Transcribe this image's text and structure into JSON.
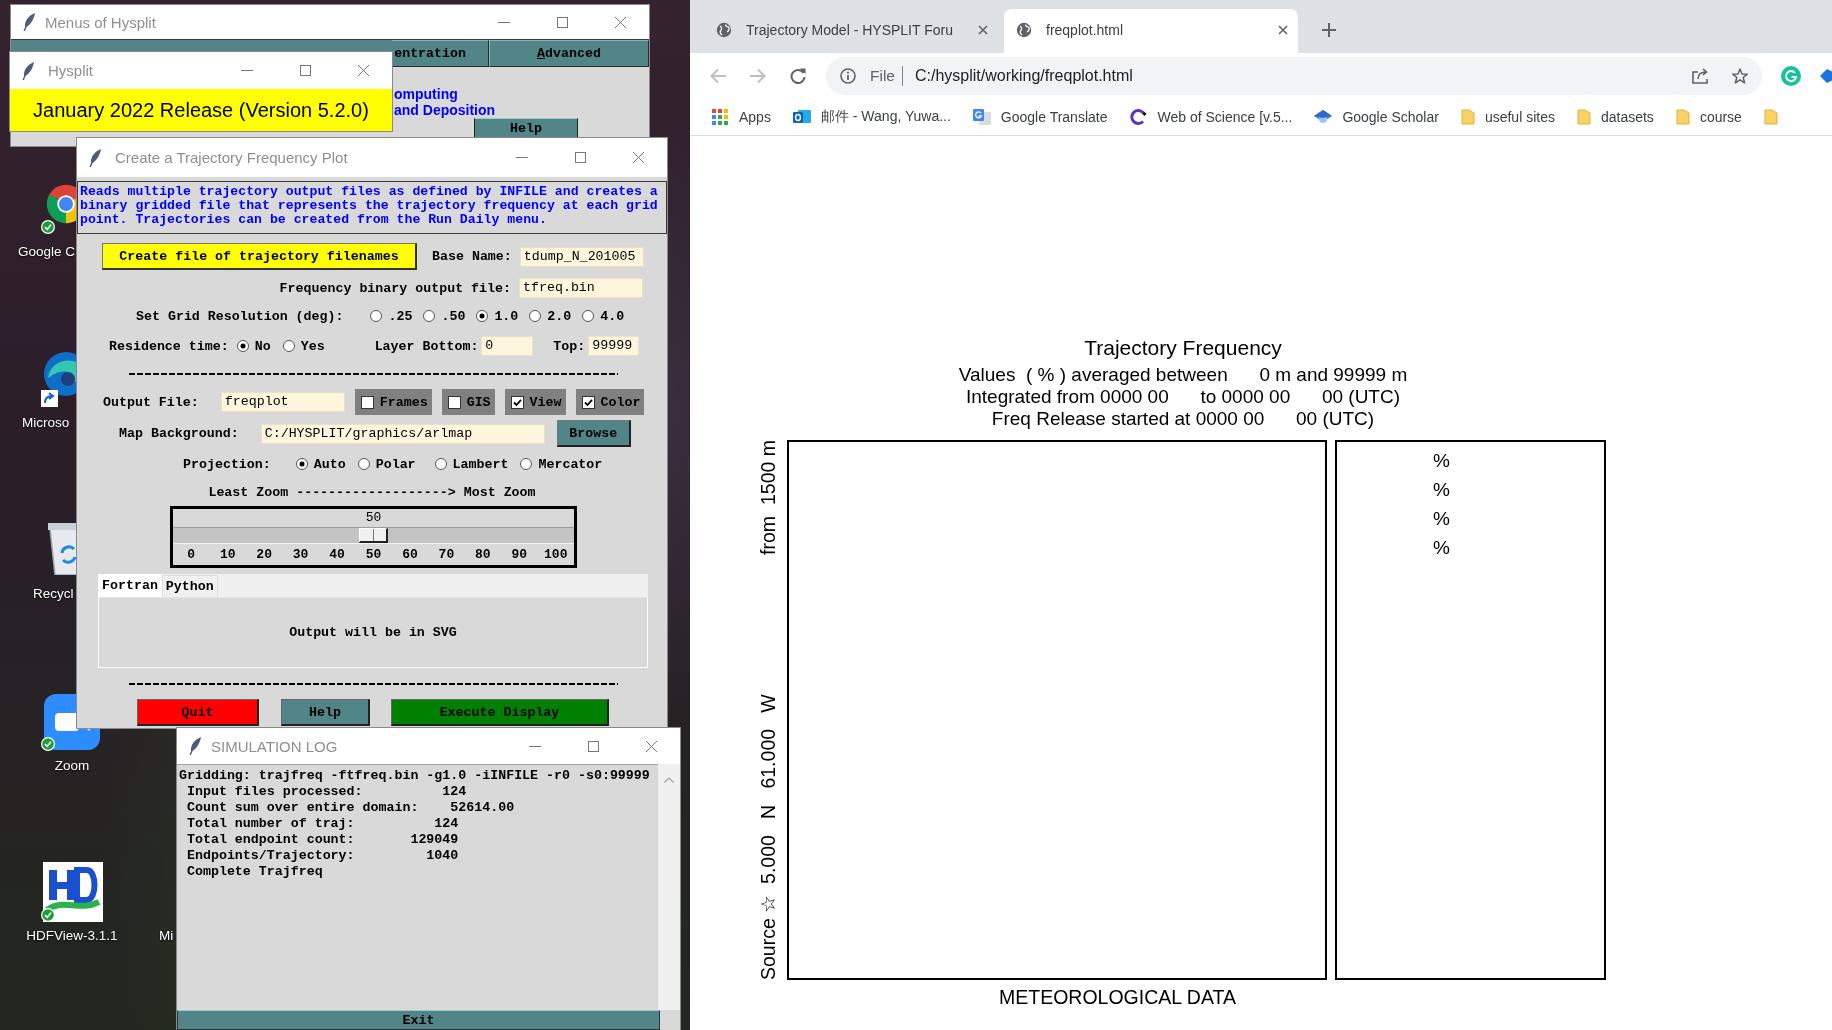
{
  "desktop": {
    "icons": [
      {
        "label": "Google C",
        "synced": true,
        "shortcut": false
      },
      {
        "label": "Microso",
        "synced": false,
        "shortcut": true
      },
      {
        "label": "Recycl",
        "synced": false,
        "shortcut": false
      },
      {
        "label": "Zoom",
        "synced": true,
        "shortcut": false
      },
      {
        "label": "HDFView-3.1.1",
        "synced": true,
        "shortcut": false
      },
      {
        "label": "Mi",
        "synced": false,
        "shortcut": false
      }
    ]
  },
  "menus_window": {
    "title": "Menus of Hysplit",
    "menu_buttons": [
      {
        "label": "entration",
        "mnemonic": false
      },
      {
        "label": "Advanced",
        "mnemonic": true
      }
    ],
    "info_lines": [
      "omputing",
      "and Deposition"
    ],
    "help_button": "Help"
  },
  "hysplit_window": {
    "title": "Hysplit",
    "banner": "January 2022 Release (Version 5.2.0)"
  },
  "freq_dialog": {
    "title": "Create a Trajectory Frequency Plot",
    "description": "Reads multiple trajectory output files as defined by INFILE and creates a binary gridded file that represents the trajectory frequency at each grid point. Trajectories can be created from the Run Daily menu.",
    "create_button": "Create file of trajectory filenames",
    "base_name": {
      "label": "Base Name:",
      "value": "tdump_N_201005"
    },
    "binary_output": {
      "label": "Frequency binary output file:",
      "value": "tfreq.bin"
    },
    "grid_resolution": {
      "label": "Set Grid Resolution (deg):",
      "options": [
        {
          "label": ".25",
          "selected": false
        },
        {
          "label": ".50",
          "selected": false
        },
        {
          "label": "1.0",
          "selected": true
        },
        {
          "label": "2.0",
          "selected": false
        },
        {
          "label": "4.0",
          "selected": false
        }
      ]
    },
    "residence_time": {
      "label": "Residence time:",
      "options": [
        {
          "label": "No",
          "selected": true
        },
        {
          "label": "Yes",
          "selected": false
        }
      ]
    },
    "layer_bottom": {
      "label": "Layer Bottom:",
      "value": "0"
    },
    "layer_top": {
      "label": "Top:",
      "value": "99999"
    },
    "output_file": {
      "label": "Output File:",
      "value": "freqplot"
    },
    "options": [
      {
        "label": "Frames",
        "checked": false
      },
      {
        "label": "GIS",
        "checked": false
      },
      {
        "label": "View",
        "checked": true
      },
      {
        "label": "Color",
        "checked": true
      }
    ],
    "map_background": {
      "label": "Map Background:",
      "value": "C:/HYSPLIT/graphics/arlmap",
      "button": "Browse"
    },
    "projection": {
      "label": "Projection:",
      "options": [
        {
          "label": "Auto",
          "selected": true
        },
        {
          "label": "Polar",
          "selected": false
        },
        {
          "label": "Lambert",
          "selected": false
        },
        {
          "label": "Mercator",
          "selected": false
        }
      ]
    },
    "zoom": {
      "caption": "Least Zoom -------------------> Most Zoom",
      "reading": "50",
      "level": 0.5,
      "ticks": [
        "0",
        "10",
        "20",
        "30",
        "40",
        "50",
        "60",
        "70",
        "80",
        "90",
        "100"
      ]
    },
    "tabs": [
      {
        "label": "Fortran",
        "selected": true
      },
      {
        "label": "Python",
        "selected": false
      }
    ],
    "tab_note": "Output will be in SVG",
    "buttons": [
      {
        "label": "Quit",
        "color": "#ff0000"
      },
      {
        "label": "Help",
        "color": "#528588"
      },
      {
        "label": "Execute Display",
        "color": "#008000"
      }
    ]
  },
  "log_window": {
    "title": "SIMULATION LOG",
    "lines": [
      "Gridding: trajfreq -ftfreq.bin -g1.0 -iINFILE -r0 -s0:99999",
      " Input files processed:          124",
      " Count sum over entire domain:    52614.00",
      " Total number of traj:          124",
      " Total endpoint count:       129049",
      " Endpoints/Trajectory:         1040",
      " Complete Trajfreq"
    ],
    "exit_button": "Exit"
  },
  "browser": {
    "tabs": [
      {
        "title": "Trajectory Model - HYSPLIT Foru",
        "selected": false
      },
      {
        "title": "freqplot.html",
        "selected": true
      }
    ],
    "nav_buttons": [
      {
        "kind": "back",
        "disabled": true
      },
      {
        "kind": "forward",
        "disabled": true
      },
      {
        "kind": "reload",
        "disabled": false
      }
    ],
    "address": {
      "scheme": "File",
      "url": "C:/hysplit/working/freqplot.html"
    },
    "bookmarks": [
      {
        "kind": "apps",
        "label": "Apps"
      },
      {
        "kind": "mail",
        "label": "邮件 - Wang, Yuwa..."
      },
      {
        "kind": "translate",
        "label": "Google Translate"
      },
      {
        "kind": "science",
        "label": "Web of Science [v.5..."
      },
      {
        "kind": "scholar",
        "label": "Google Scholar"
      },
      {
        "kind": "folder",
        "label": "useful sites"
      },
      {
        "kind": "folder",
        "label": "datasets"
      },
      {
        "kind": "folder",
        "label": "course"
      },
      {
        "kind": "folder"
      }
    ],
    "page": {
      "title": "Trajectory Frequency",
      "info_lines": [
        "Values  ( % ) averaged between      0 m and 99999 m",
        "Integrated from 0000 00      to 0000 00      00 (UTC)",
        "Freq Release started at 0000 00      00 (UTC)"
      ],
      "side_labels": [
        "Source ☆  5.000   N   61.000   W",
        "from  1500 m"
      ],
      "legend_entries": [
        "%",
        "%",
        "%",
        "%"
      ],
      "footer": "METEOROLOGICAL DATA"
    }
  }
}
